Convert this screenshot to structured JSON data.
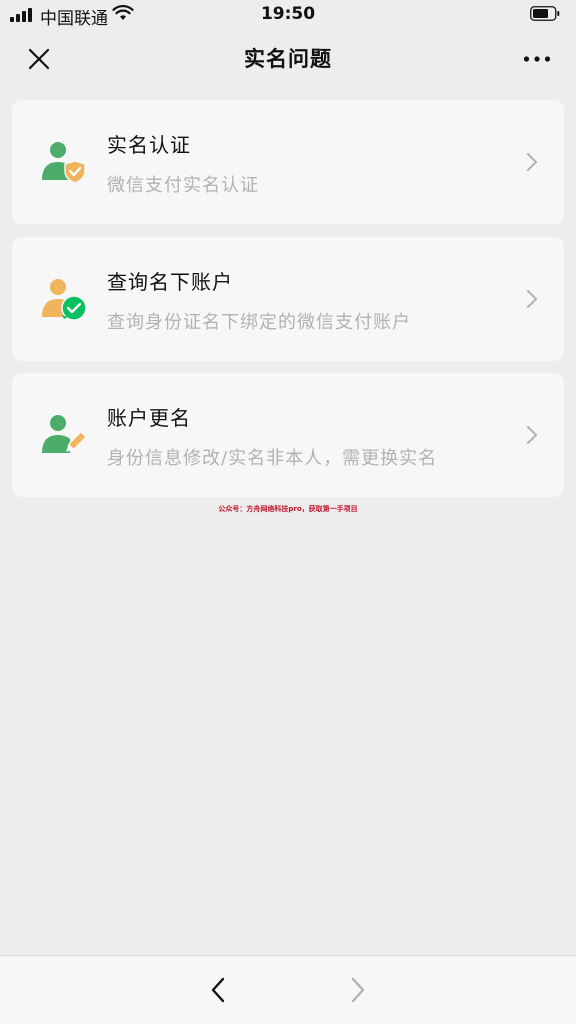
{
  "status_bar": {
    "carrier": "中国联通",
    "time": "19:50"
  },
  "nav": {
    "title": "实名问题",
    "close_icon": "close-icon",
    "more_icon": "more-icon"
  },
  "cards": [
    {
      "title": "实名认证",
      "subtitle": "微信支付实名认证",
      "icon": "user-shield-icon"
    },
    {
      "title": "查询名下账户",
      "subtitle": "查询身份证名下绑定的微信支付账户",
      "icon": "user-check-icon"
    },
    {
      "title": "账户更名",
      "subtitle": "身份信息修改/实名非本人，需更换实名",
      "icon": "user-edit-icon"
    }
  ],
  "watermark": "公众号：方舟网络科技pro，获取第一手项目",
  "bottom_bar": {
    "back_icon": "chevron-left-icon",
    "forward_icon": "chevron-right-icon"
  },
  "colors": {
    "background": "#ededed",
    "card": "#f7f7f7",
    "green": "#4cad6a",
    "orange": "#f0b45c",
    "wechat_green": "#07c160",
    "subtitle": "#b2b2b2"
  }
}
